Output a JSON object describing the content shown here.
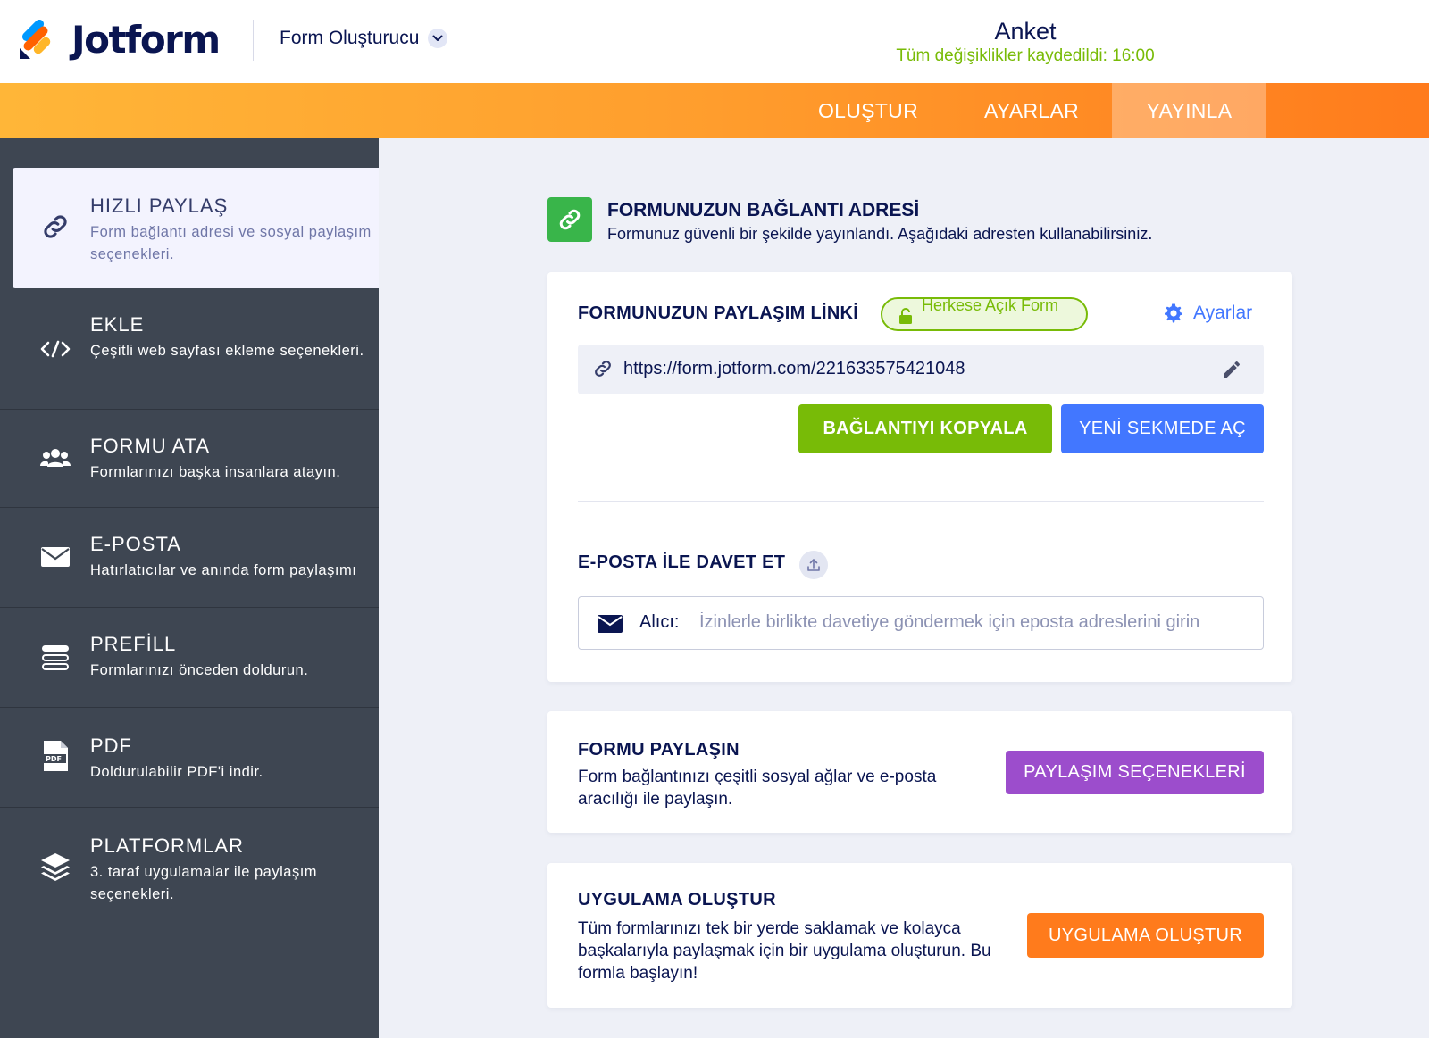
{
  "header": {
    "logo_text": "Jotform",
    "builder_label": "Form Oluşturucu",
    "form_title": "Anket",
    "save_status": "Tüm değişiklikler kaydedildi: 16:00"
  },
  "nav": {
    "tabs": [
      {
        "label": "OLUŞTUR"
      },
      {
        "label": "AYARLAR"
      },
      {
        "label": "YAYINLA",
        "active": true
      }
    ]
  },
  "sidebar": {
    "items": [
      {
        "title": "HIZLI PAYLAŞ",
        "desc": "Form bağlantı adresi ve sosyal paylaşım seçenekleri.",
        "icon": "link-icon",
        "active": true
      },
      {
        "title": "EKLE",
        "desc": "Çeşitli web sayfası ekleme seçenekleri.",
        "icon": "code-icon"
      },
      {
        "title": "FORMU ATA",
        "desc": "Formlarınızı başka insanlara atayın.",
        "icon": "users-icon"
      },
      {
        "title": "E-POSTA",
        "desc": "Hatırlatıcılar ve anında form paylaşımı",
        "icon": "envelope-icon"
      },
      {
        "title": "PREFİLL",
        "desc": "Formlarınızı önceden doldurun.",
        "icon": "prefill-icon"
      },
      {
        "title": "PDF",
        "desc": "Doldurulabilir PDF'i indir.",
        "icon": "pdf-icon"
      },
      {
        "title": "PLATFORMLAR",
        "desc": "3. taraf uygulamalar ile paylaşım seçenekleri.",
        "icon": "layers-icon"
      }
    ]
  },
  "main": {
    "section_title": "FORMUNUZUN BAĞLANTI ADRESİ",
    "section_subtitle": "Formunuz güvenli bir şekilde yayınlandı. Aşağıdaki adresten kullanabilirsiniz.",
    "share_link": {
      "label": "FORMUNUZUN PAYLAŞIM LİNKİ",
      "badge": "Herkese Açık Form",
      "settings": "Ayarlar",
      "url": "https://form.jotform.com/221633575421048",
      "copy_button": "BAĞLANTIYI KOPYALA",
      "open_button": "YENİ SEKMEDE AÇ"
    },
    "invite": {
      "label": "E-POSTA İLE DAVET ET",
      "to_label": "Alıcı:",
      "placeholder": "İzinlerle birlikte davetiye göndermek için eposta adreslerini girin"
    },
    "share_form": {
      "title": "FORMU PAYLAŞIN",
      "desc": "Form bağlantınızı çeşitli sosyal ağlar ve e-posta aracılığı ile paylaşın.",
      "button": "PAYLAŞIM SEÇENEKLERİ"
    },
    "create_app": {
      "title": "UYGULAMA OLUŞTUR",
      "desc": "Tüm formlarınızı tek bir yerde saklamak ve kolayca başkalarıyla paylaşmak için bir uygulama oluşturun. Bu formla başlayın!",
      "button": "UYGULAMA OLUŞTUR"
    }
  },
  "colors": {
    "green": "#78bb07",
    "blue": "#4277ff",
    "purple": "#9c4dcc",
    "orange": "#ff7b1c",
    "sidebar": "#3e4652",
    "navy": "#0a1551"
  }
}
